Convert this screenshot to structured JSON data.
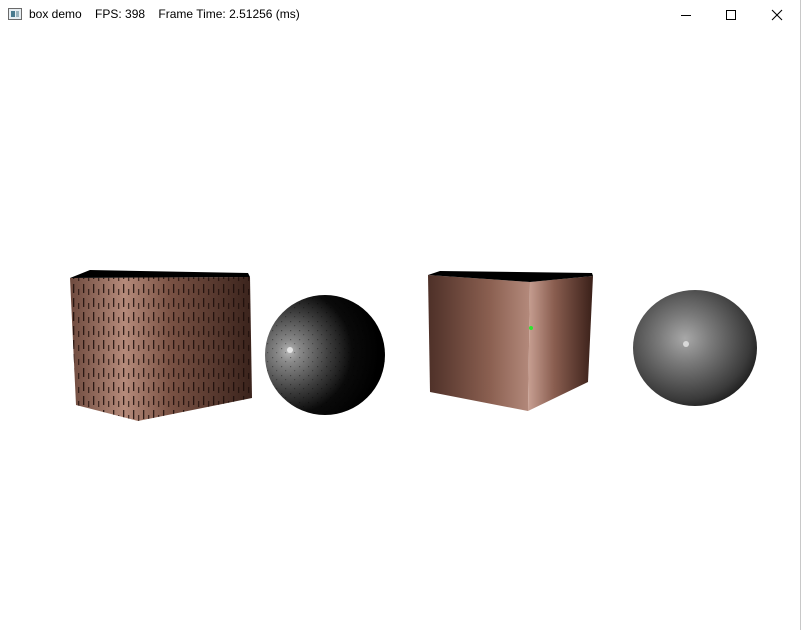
{
  "window": {
    "title": "box demo",
    "fps_label": "FPS: 398",
    "frame_time_label": "Frame Time: 2.51256 (ms)",
    "controls": {
      "minimize": "minimize-icon",
      "maximize": "maximize-icon",
      "close": "close-icon"
    }
  },
  "scene": {
    "background": "#ffffff",
    "objects": [
      {
        "kind": "cube",
        "material": "wood-texture",
        "color": "#8a5a4a"
      },
      {
        "kind": "sphere",
        "material": "speckled-gray",
        "color": "#7a7a7a"
      },
      {
        "kind": "cube",
        "material": "brushed-copper",
        "color": "#9a6a58"
      },
      {
        "kind": "sphere",
        "material": "gray",
        "color": "#7e7e7e"
      }
    ]
  }
}
